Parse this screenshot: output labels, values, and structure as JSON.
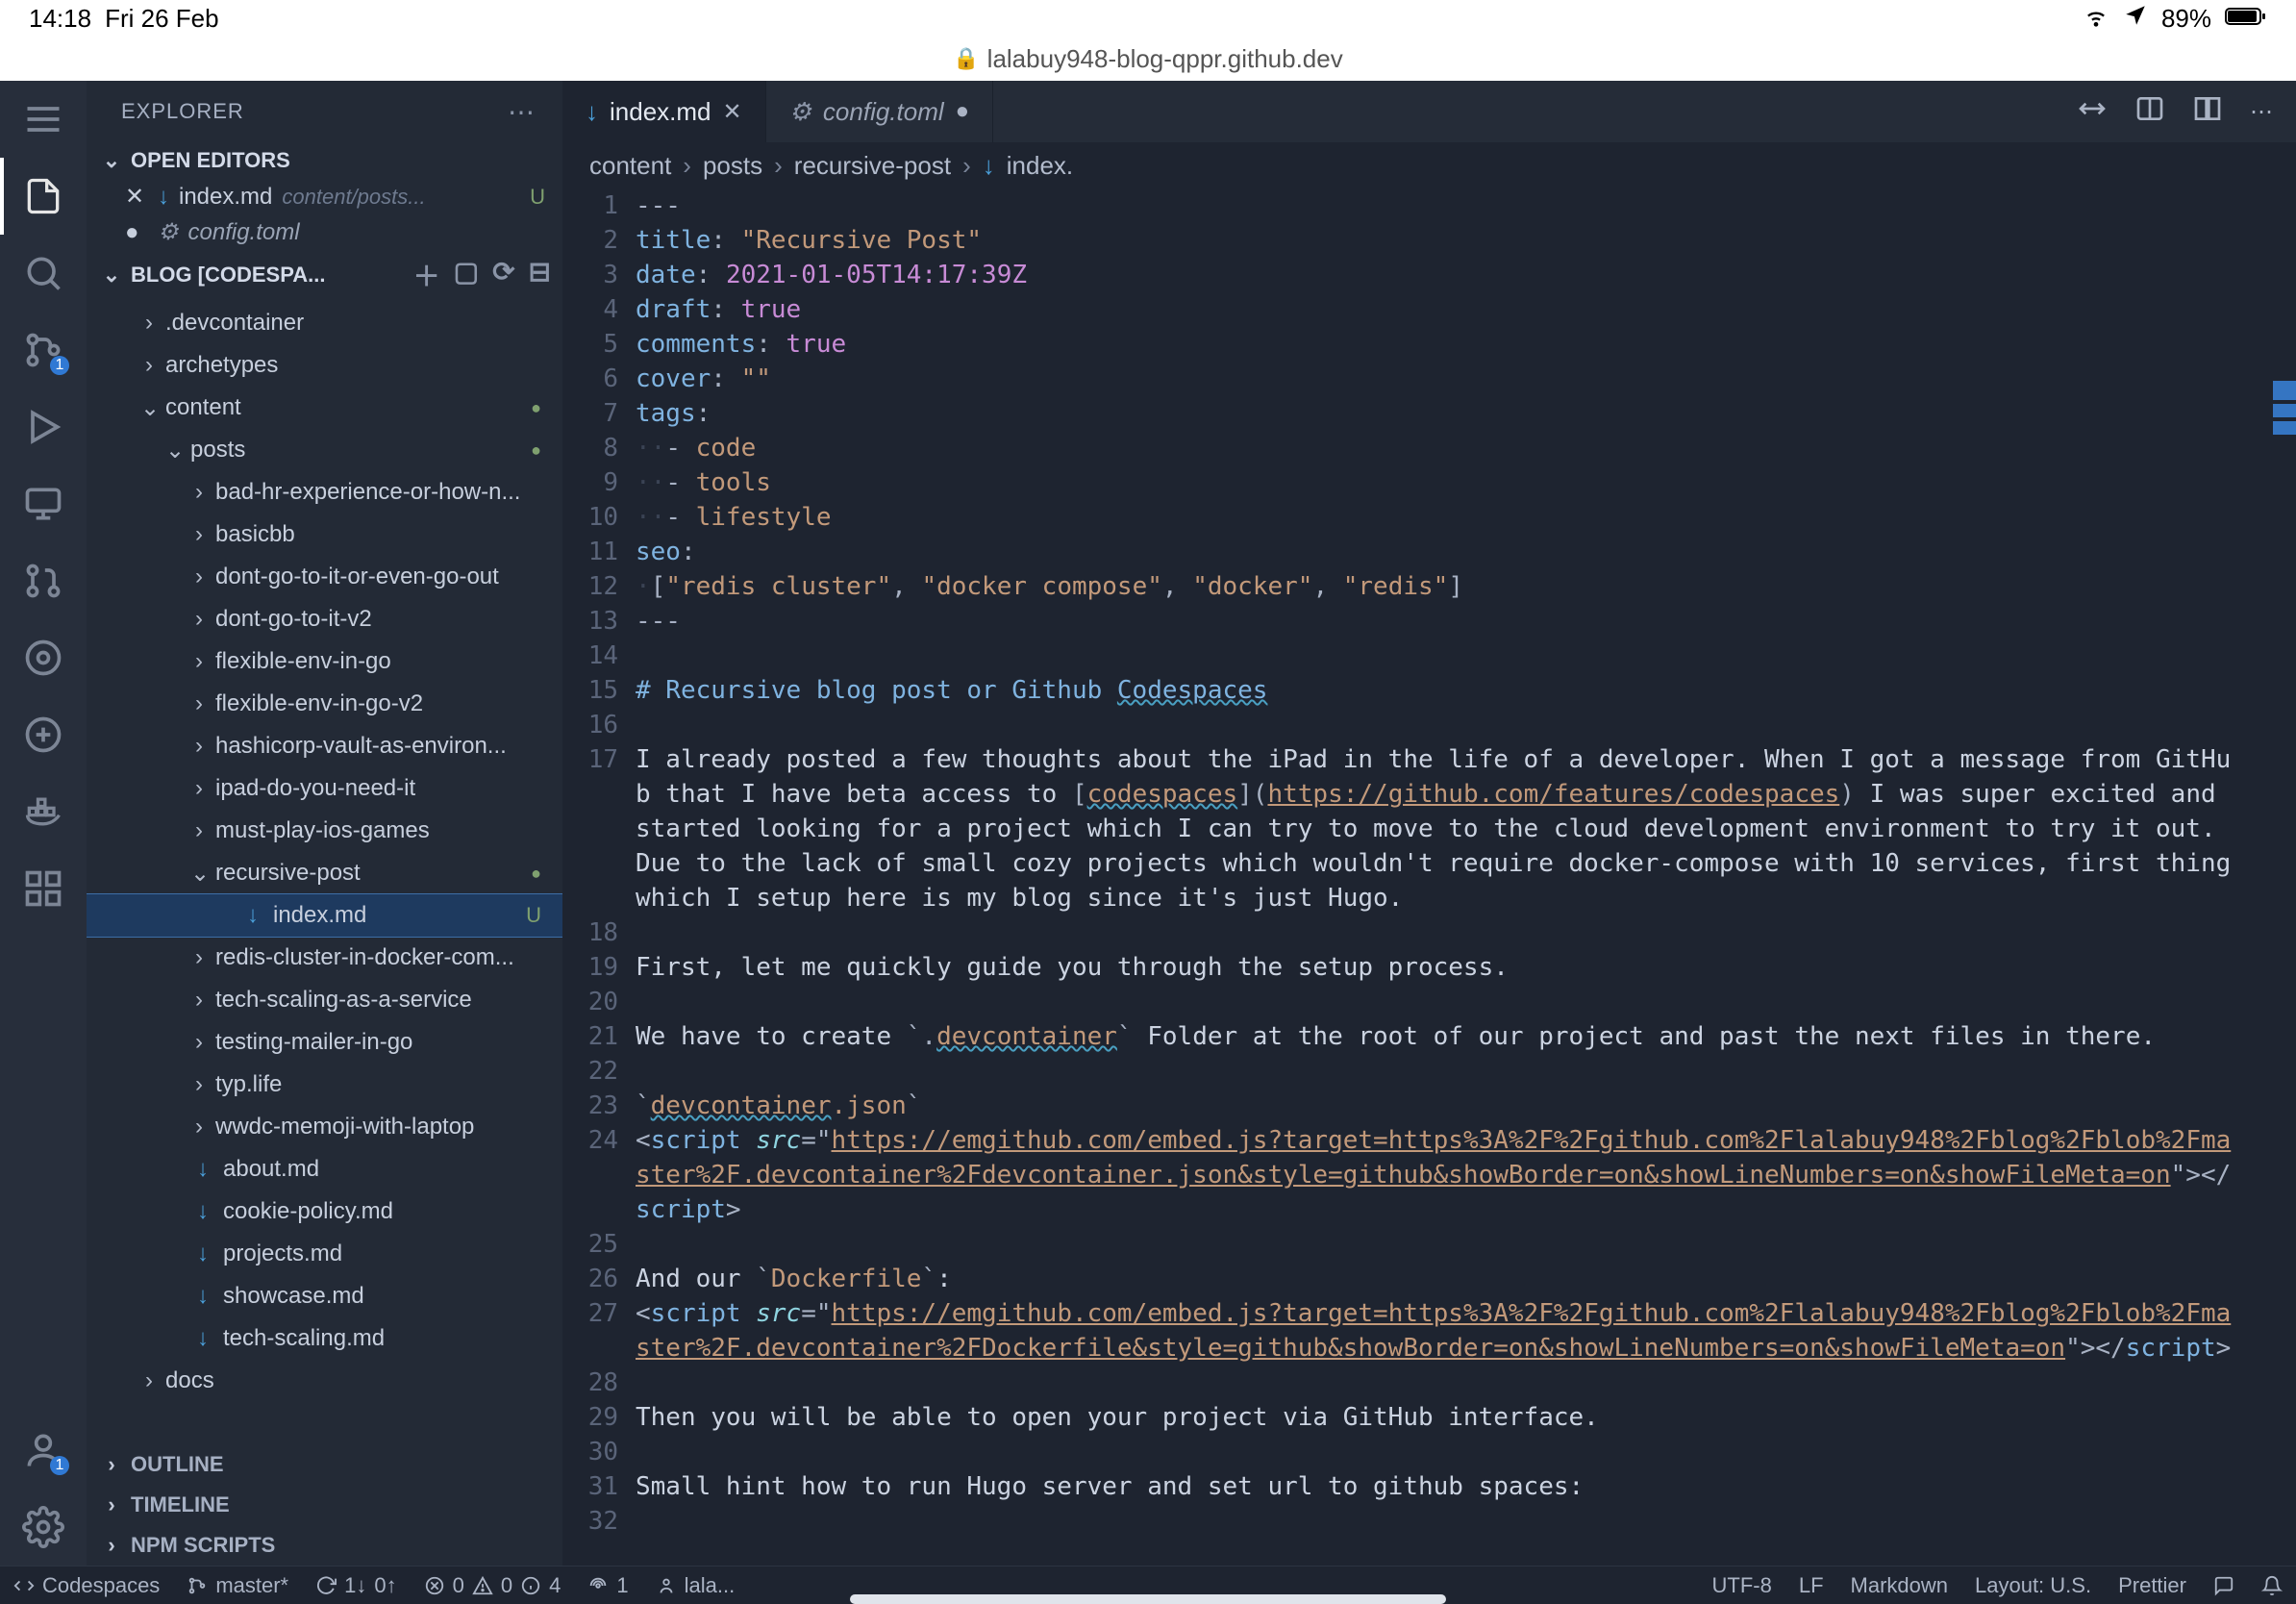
{
  "ipad_status": {
    "time": "14:18",
    "date": "Fri 26 Feb",
    "battery": "89%"
  },
  "browser": {
    "host": "lalabuy948-blog-qppr.github.dev"
  },
  "sidebar": {
    "title": "EXPLORER",
    "section_open_editors": "OPEN EDITORS",
    "section_workspace": "BLOG [CODESPA...",
    "section_outline": "OUTLINE",
    "section_timeline": "TIMELINE",
    "section_npm": "NPM SCRIPTS"
  },
  "open_editors": [
    {
      "name": "index.md",
      "path": "content/posts...",
      "status": "U",
      "icon": "md"
    },
    {
      "name": "config.toml",
      "path": "",
      "status": "",
      "modified": true,
      "icon": "gear"
    }
  ],
  "tree": [
    {
      "depth": 1,
      "kind": "folder",
      "name": ".devcontainer",
      "expanded": false
    },
    {
      "depth": 1,
      "kind": "folder",
      "name": "archetypes",
      "expanded": false
    },
    {
      "depth": 1,
      "kind": "folder",
      "name": "content",
      "expanded": true,
      "dot": true
    },
    {
      "depth": 2,
      "kind": "folder",
      "name": "posts",
      "expanded": true,
      "dot": true
    },
    {
      "depth": 3,
      "kind": "folder",
      "name": "bad-hr-experience-or-how-n...",
      "expanded": false
    },
    {
      "depth": 3,
      "kind": "folder",
      "name": "basicbb",
      "expanded": false
    },
    {
      "depth": 3,
      "kind": "folder",
      "name": "dont-go-to-it-or-even-go-out",
      "expanded": false
    },
    {
      "depth": 3,
      "kind": "folder",
      "name": "dont-go-to-it-v2",
      "expanded": false
    },
    {
      "depth": 3,
      "kind": "folder",
      "name": "flexible-env-in-go",
      "expanded": false
    },
    {
      "depth": 3,
      "kind": "folder",
      "name": "flexible-env-in-go-v2",
      "expanded": false
    },
    {
      "depth": 3,
      "kind": "folder",
      "name": "hashicorp-vault-as-environ...",
      "expanded": false
    },
    {
      "depth": 3,
      "kind": "folder",
      "name": "ipad-do-you-need-it",
      "expanded": false
    },
    {
      "depth": 3,
      "kind": "folder",
      "name": "must-play-ios-games",
      "expanded": false
    },
    {
      "depth": 3,
      "kind": "folder",
      "name": "recursive-post",
      "expanded": true,
      "dot": true
    },
    {
      "depth": 4,
      "kind": "file",
      "name": "index.md",
      "icon": "md",
      "selected": true,
      "statusU": true
    },
    {
      "depth": 3,
      "kind": "folder",
      "name": "redis-cluster-in-docker-com...",
      "expanded": false
    },
    {
      "depth": 3,
      "kind": "folder",
      "name": "tech-scaling-as-a-service",
      "expanded": false
    },
    {
      "depth": 3,
      "kind": "folder",
      "name": "testing-mailer-in-go",
      "expanded": false
    },
    {
      "depth": 3,
      "kind": "folder",
      "name": "typ.life",
      "expanded": false
    },
    {
      "depth": 3,
      "kind": "folder",
      "name": "wwdc-memoji-with-laptop",
      "expanded": false
    },
    {
      "depth": 2,
      "kind": "file",
      "name": "about.md",
      "icon": "md"
    },
    {
      "depth": 2,
      "kind": "file",
      "name": "cookie-policy.md",
      "icon": "md"
    },
    {
      "depth": 2,
      "kind": "file",
      "name": "projects.md",
      "icon": "md"
    },
    {
      "depth": 2,
      "kind": "file",
      "name": "showcase.md",
      "icon": "md"
    },
    {
      "depth": 2,
      "kind": "file",
      "name": "tech-scaling.md",
      "icon": "md"
    },
    {
      "depth": 1,
      "kind": "folder",
      "name": "docs",
      "expanded": false
    }
  ],
  "tabs": [
    {
      "name": "index.md",
      "active": true,
      "dirty": false,
      "icon": "md"
    },
    {
      "name": "config.toml",
      "active": false,
      "dirty": true,
      "icon": "gear"
    }
  ],
  "breadcrumb": [
    "content",
    "posts",
    "recursive-post",
    "index."
  ],
  "code": {
    "lines": [
      {
        "n": 1,
        "html": "<span class='tk-dash'>---</span>"
      },
      {
        "n": 2,
        "html": "<span class='tk-key'>title</span><span class='tk-punc'>:</span> <span class='tk-str'>\"Recursive Post\"</span>"
      },
      {
        "n": 3,
        "html": "<span class='tk-key'>date</span><span class='tk-punc'>:</span> <span class='tk-num'>2021-01-05T14:17:39Z</span>"
      },
      {
        "n": 4,
        "html": "<span class='tk-key'>draft</span><span class='tk-punc'>:</span> <span class='tk-bool'>true</span>"
      },
      {
        "n": 5,
        "html": "<span class='tk-key'>comments</span><span class='tk-punc'>:</span> <span class='tk-bool'>true</span>"
      },
      {
        "n": 6,
        "html": "<span class='tk-key'>cover</span><span class='tk-punc'>:</span> <span class='tk-str'>\"\"</span>"
      },
      {
        "n": 7,
        "html": "<span class='tk-key'>tags</span><span class='tk-punc'>:</span>"
      },
      {
        "n": 8,
        "html": "<span class='ws-dot'>··</span><span class='tk-punc'>-</span> <span class='tk-str'>code</span>"
      },
      {
        "n": 9,
        "html": "<span class='ws-dot'>··</span><span class='tk-punc'>-</span> <span class='tk-str'>tools</span>"
      },
      {
        "n": 10,
        "html": "<span class='ws-dot'>··</span><span class='tk-punc'>-</span> <span class='tk-str'>lifestyle</span>"
      },
      {
        "n": 11,
        "html": "<span class='tk-key'>seo</span><span class='tk-punc'>:</span>"
      },
      {
        "n": 12,
        "html": "<span class='ws-dot'>·</span><span class='tk-punc'>[</span><span class='tk-str'>\"redis cluster\"</span><span class='tk-punc'>,</span> <span class='tk-str'>\"docker compose\"</span><span class='tk-punc'>,</span> <span class='tk-str'>\"docker\"</span><span class='tk-punc'>,</span> <span class='tk-str'>\"redis\"</span><span class='tk-punc'>]</span>"
      },
      {
        "n": 13,
        "html": "<span class='tk-dash'>---</span>"
      },
      {
        "n": 14,
        "html": ""
      },
      {
        "n": 15,
        "html": "<span class='tk-heading'># Recursive blog post or Github </span><span class='tk-heading tk-squiggle'>Codespaces</span>"
      },
      {
        "n": 16,
        "html": ""
      },
      {
        "n": 17,
        "html": "I already posted a few thoughts about the iPad in the life of a developer. When I got a message from GitHub that I have beta access to <span class='tk-punc'>[</span><span class='tk-link tk-squiggle'>codespaces</span><span class='tk-punc'>](</span><span class='tk-url'>https://github.com/features/codespaces</span><span class='tk-punc'>)</span> I was super excited and started looking for a project which I can try to move to the cloud development environment to try it out. Due to the lack of small cozy projects which wouldn't require docker-compose with 10 services, first thing which I setup here is my blog since it's just Hugo."
      },
      {
        "n": 18,
        "html": ""
      },
      {
        "n": 19,
        "html": "First, let me quickly guide you through the setup process."
      },
      {
        "n": 20,
        "html": ""
      },
      {
        "n": 21,
        "html": "We have to create <span class='tk-punc'>`.</span><span class='tk-str tk-squiggle'>devcontainer</span><span class='tk-punc'>`</span> Folder at the root of our project and past the next files in there."
      },
      {
        "n": 22,
        "html": ""
      },
      {
        "n": 23,
        "html": "<span class='tk-punc'>`</span><span class='tk-str tk-squiggle'>devcontainer</span><span class='tk-str'>.json</span><span class='tk-punc'>`</span>"
      },
      {
        "n": 24,
        "html": "<span class='tk-punc'>&lt;</span><span class='tk-tag'>script</span> <span class='tk-attr'>src</span><span class='tk-punc'>=\"</span><span class='tk-url'>https://emgithub.com/embed.js?target=https%3A%2F%2Fgithub.com%2Flalabuy948%2Fblog%2Fblob%2Fmaster%2F.devcontainer%2Fdevcontainer.json&style=github&showBorder=on&showLineNumbers=on&showFileMeta=on</span><span class='tk-punc'>\"&gt;&lt;/</span><span class='tk-tag'>script</span><span class='tk-punc'>&gt;</span>"
      },
      {
        "n": 25,
        "html": ""
      },
      {
        "n": 26,
        "html": "And our <span class='tk-punc'>`</span><span class='tk-str'>Dockerfile</span><span class='tk-punc'>`</span>:"
      },
      {
        "n": 27,
        "html": "<span class='tk-punc'>&lt;</span><span class='tk-tag'>script</span> <span class='tk-attr'>src</span><span class='tk-punc'>=\"</span><span class='tk-url'>https://emgithub.com/embed.js?target=https%3A%2F%2Fgithub.com%2Flalabuy948%2Fblog%2Fblob%2Fmaster%2F.devcontainer%2FDockerfile&style=github&showBorder=on&showLineNumbers=on&showFileMeta=on</span><span class='tk-punc'>\"&gt;&lt;/</span><span class='tk-tag'>script</span><span class='tk-punc'>&gt;</span>"
      },
      {
        "n": 28,
        "html": ""
      },
      {
        "n": 29,
        "html": "Then you will be able to open your project via GitHub interface."
      },
      {
        "n": 30,
        "html": ""
      },
      {
        "n": 31,
        "html": "Small hint how to run Hugo server and set url to github spaces:"
      },
      {
        "n": 32,
        "html": ""
      }
    ]
  },
  "statusbar": {
    "codespaces": "Codespaces",
    "branch": "master*",
    "sync_up": "1↓",
    "sync_down": "0↑",
    "errors": "0",
    "warnings": "0",
    "infos": "4",
    "ports": "1",
    "user": "lala...",
    "encoding": "UTF-8",
    "eol": "LF",
    "lang": "Markdown",
    "layout": "Layout: U.S.",
    "formatter": "Prettier"
  }
}
